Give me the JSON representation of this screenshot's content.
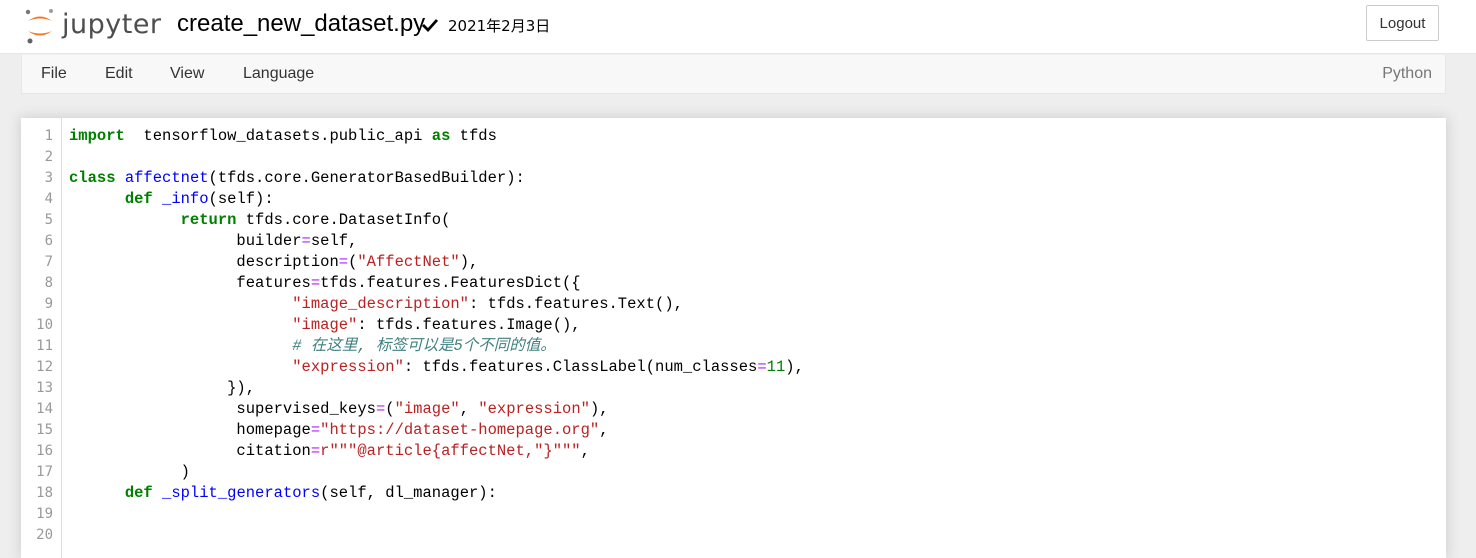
{
  "header": {
    "logo_text": "jupyter",
    "filename": "create_new_dataset.py",
    "save_status": "2021年2月3日",
    "logout_label": "Logout"
  },
  "menubar": {
    "items": [
      {
        "label": "File"
      },
      {
        "label": "Edit"
      },
      {
        "label": "View"
      },
      {
        "label": "Language"
      }
    ],
    "language_mode": "Python"
  },
  "colors": {
    "keyword": "#008000",
    "definition": "#0000ff",
    "operator": "#aa22ff",
    "string": "#ba2121",
    "comment": "#408080",
    "logo_orange": "#f37726"
  },
  "editor": {
    "line_numbers": [
      "1",
      "2",
      "3",
      "4",
      "5",
      "6",
      "7",
      "8",
      "9",
      "10",
      "11",
      "12",
      "13",
      "14",
      "15",
      "16",
      "17",
      "18",
      "19",
      "20"
    ],
    "lines": [
      [
        [
          "kw",
          "import"
        ],
        [
          "",
          "  tensorflow_datasets.public_api "
        ],
        [
          "kw",
          "as"
        ],
        [
          "",
          " tfds"
        ]
      ],
      [],
      [
        [
          "kw",
          "class"
        ],
        [
          "",
          " "
        ],
        [
          "def",
          "affectnet"
        ],
        [
          "",
          "(tfds.core.GeneratorBasedBuilder):"
        ]
      ],
      [
        [
          "",
          "      "
        ],
        [
          "kw",
          "def"
        ],
        [
          "",
          " "
        ],
        [
          "def",
          "_info"
        ],
        [
          "",
          "(self):"
        ]
      ],
      [
        [
          "",
          "            "
        ],
        [
          "kw",
          "return"
        ],
        [
          "",
          " tfds.core.DatasetInfo("
        ]
      ],
      [
        [
          "",
          "                  builder"
        ],
        [
          "op",
          "="
        ],
        [
          "",
          "self,"
        ]
      ],
      [
        [
          "",
          "                  description"
        ],
        [
          "op",
          "="
        ],
        [
          "",
          "("
        ],
        [
          "str",
          "\"AffectNet\""
        ],
        [
          "",
          "),"
        ]
      ],
      [
        [
          "",
          "                  features"
        ],
        [
          "op",
          "="
        ],
        [
          "",
          "tfds.features.FeaturesDict({"
        ]
      ],
      [
        [
          "",
          "                        "
        ],
        [
          "str",
          "\"image_description\""
        ],
        [
          "",
          ": tfds.features.Text(),"
        ]
      ],
      [
        [
          "",
          "                        "
        ],
        [
          "str",
          "\"image\""
        ],
        [
          "",
          ": tfds.features.Image(),"
        ]
      ],
      [
        [
          "",
          "                        "
        ],
        [
          "com",
          "# 在这里, 标签可以是5个不同的值。"
        ]
      ],
      [
        [
          "",
          "                        "
        ],
        [
          "str",
          "\"expression\""
        ],
        [
          "",
          ": tfds.features.ClassLabel(num_classes"
        ],
        [
          "op",
          "="
        ],
        [
          "num",
          "11"
        ],
        [
          "",
          "),"
        ]
      ],
      [
        [
          "",
          "                 }),"
        ]
      ],
      [
        [
          "",
          "                  supervised_keys"
        ],
        [
          "op",
          "="
        ],
        [
          "",
          "("
        ],
        [
          "str",
          "\"image\""
        ],
        [
          "",
          ", "
        ],
        [
          "str",
          "\"expression\""
        ],
        [
          "",
          "),"
        ]
      ],
      [
        [
          "",
          "                  homepage"
        ],
        [
          "op",
          "="
        ],
        [
          "str",
          "\"https://dataset-homepage.org\""
        ],
        [
          "",
          ","
        ]
      ],
      [
        [
          "",
          "                  citation"
        ],
        [
          "op",
          "="
        ],
        [
          "str",
          "r\"\"\"@article{affectNet,\"}\"\"\""
        ],
        [
          "",
          ","
        ]
      ],
      [
        [
          "",
          "            )"
        ]
      ],
      [
        [
          "",
          "      "
        ],
        [
          "kw",
          "def"
        ],
        [
          "",
          " "
        ],
        [
          "def",
          "_split_generators"
        ],
        [
          "",
          "(self, dl_manager):"
        ]
      ],
      [],
      []
    ]
  }
}
